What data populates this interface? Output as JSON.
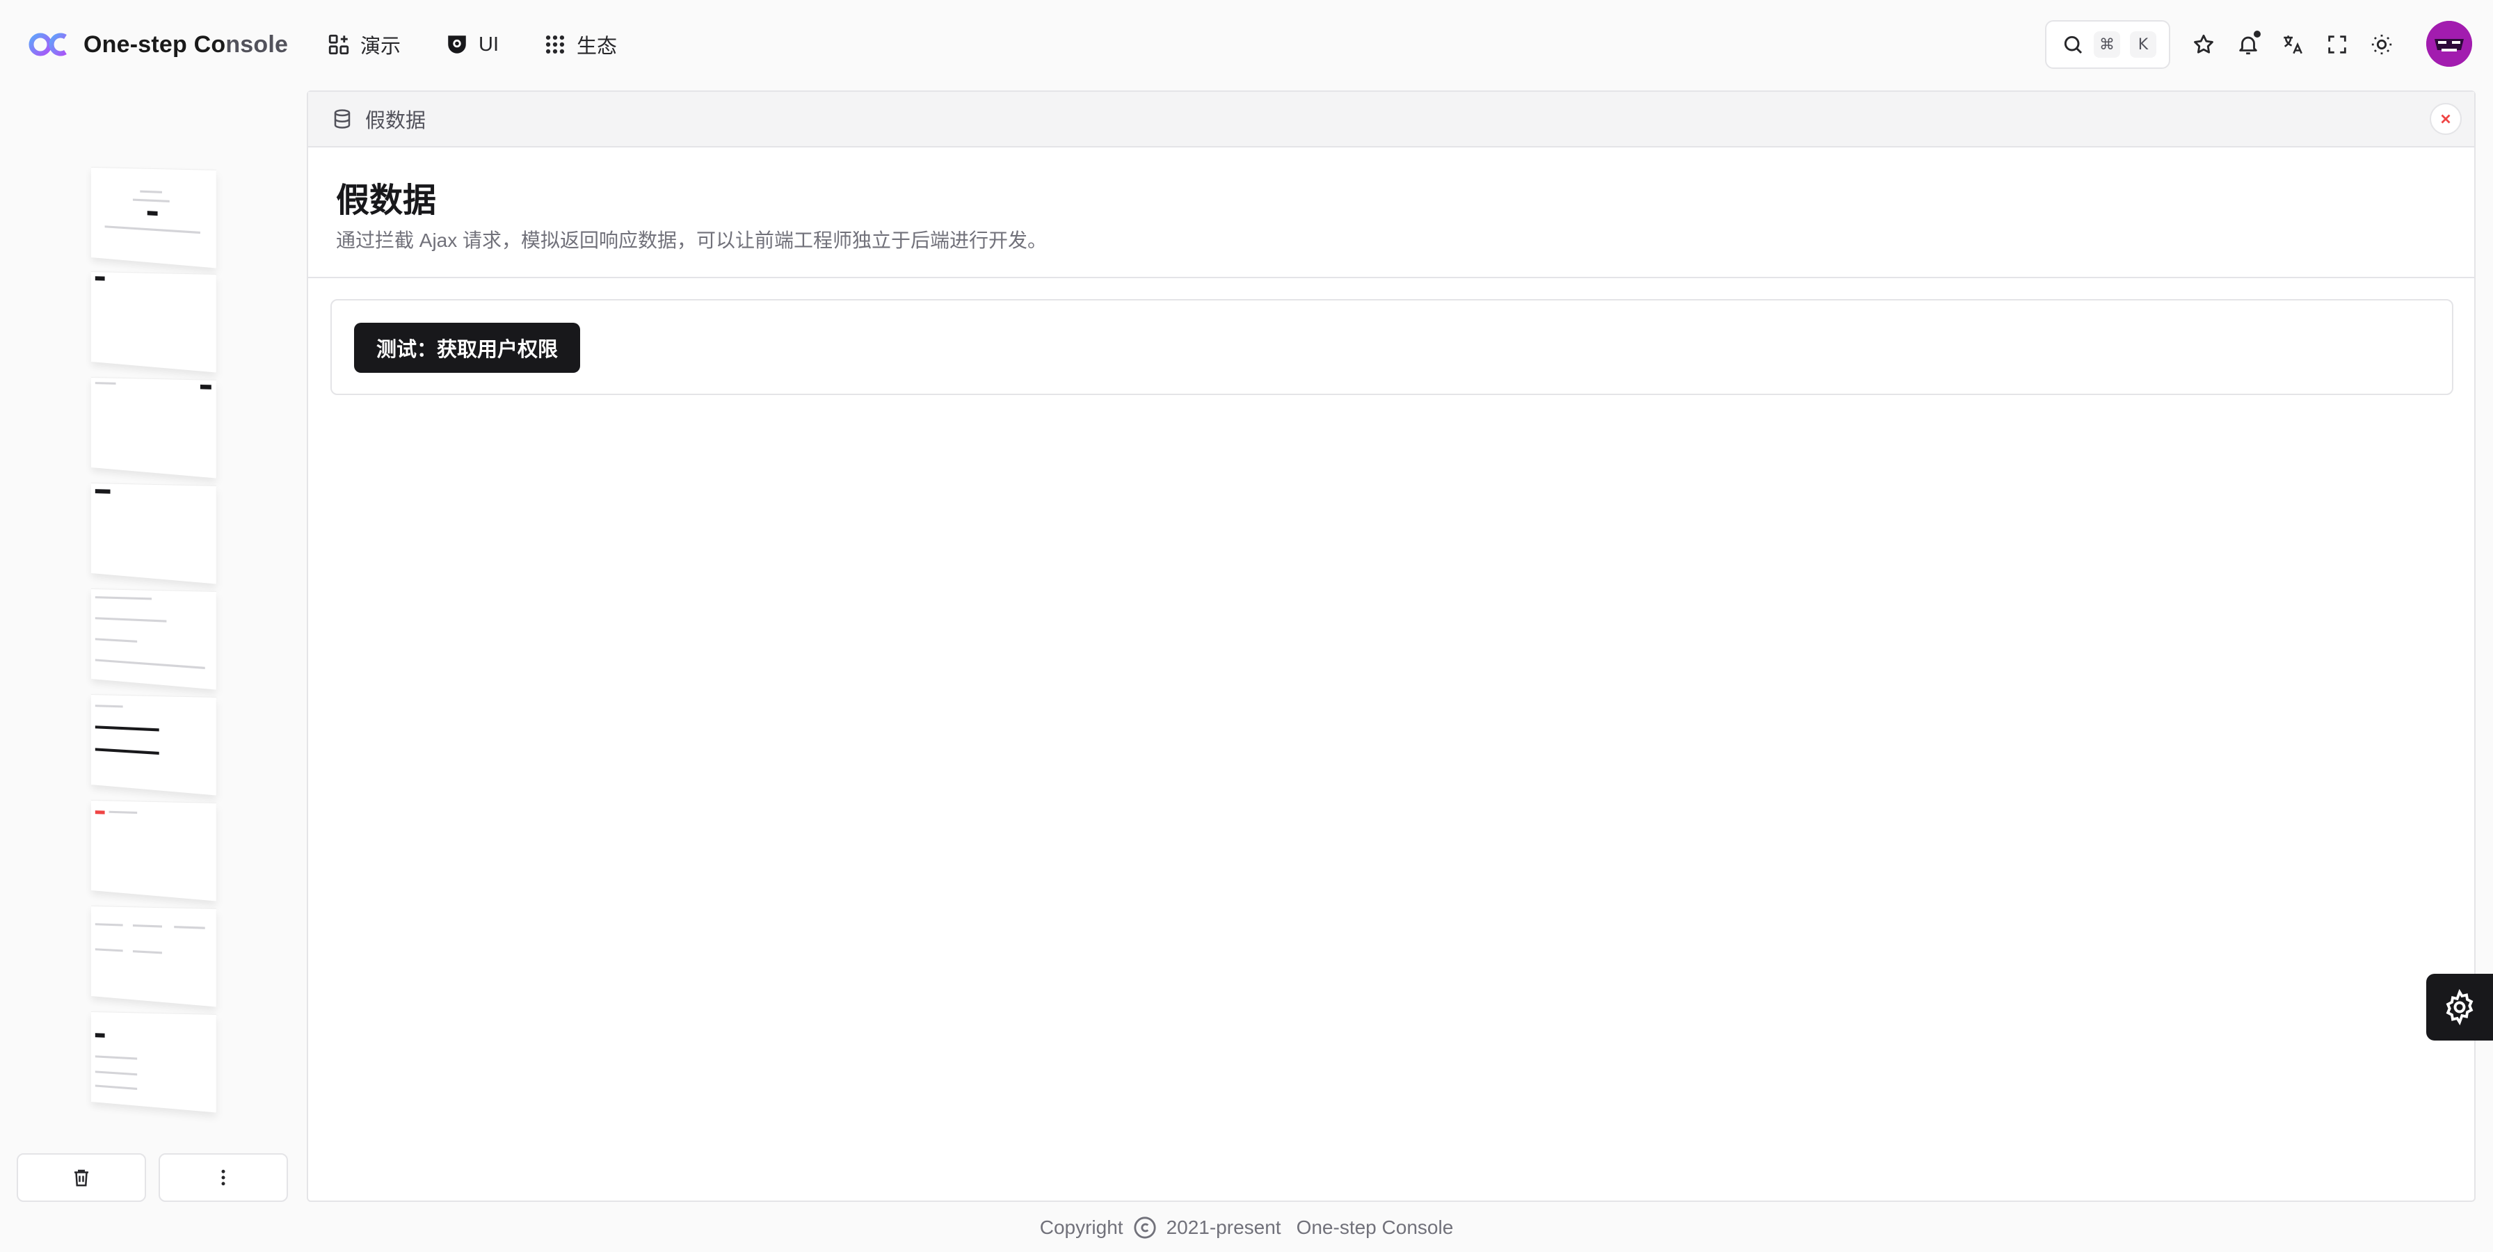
{
  "header": {
    "brand_primary": "One-step Co",
    "brand_secondary": "nsole",
    "nav": [
      {
        "label": "演示",
        "icon": "dashboard-plus-icon"
      },
      {
        "label": "UI",
        "icon": "ui-shield-icon"
      },
      {
        "label": "生态",
        "icon": "grid-dots-icon"
      }
    ],
    "search": {
      "icon": "search-icon",
      "kbd_cmd": "⌘",
      "kbd_key": "K"
    },
    "tools": [
      "star-icon",
      "bell-icon",
      "translate-icon",
      "fullscreen-icon",
      "sun-icon"
    ],
    "avatar": "avatar"
  },
  "sidebar": {
    "thumbnail_count": 9,
    "delete_button_icon": "trash-icon",
    "more_button_icon": "more-vertical-icon"
  },
  "tab": {
    "icon": "database-icon",
    "label": "假数据",
    "close_icon": "close-icon"
  },
  "page": {
    "title": "假数据",
    "description": "通过拦截 Ajax 请求，模拟返回响应数据，可以让前端工程师独立于后端进行开发。",
    "test_button": "测试：获取用户权限"
  },
  "footer": {
    "copyright": "Copyright",
    "years": "2021-present",
    "name": "One-step Console"
  },
  "colors": {
    "accent": "#18181b",
    "logo_blue": "#3b82f6",
    "logo_purple": "#8b5cf6",
    "avatar_bg": "#a21caf",
    "close_red": "#ef4444"
  }
}
